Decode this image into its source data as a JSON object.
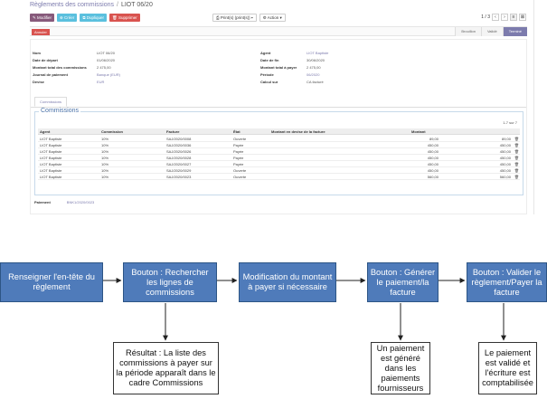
{
  "screenshot": {
    "breadcrumb": {
      "parent": "Règlements des commissions",
      "separator": "/",
      "current": "LIOT 06/20"
    },
    "buttons": {
      "modifier": "✎ Modifier",
      "creer": "⊕ Créer",
      "dupliquer": "⧉ Dupliquer",
      "supprimer": "🗑 Supprimer",
      "print": "⎙ Print(s) (print(s)) ▾",
      "action": "⚙ Action ▾"
    },
    "pager": {
      "text": "1 / 3",
      "prev": "‹",
      "next": "›",
      "grid": "≡",
      "close": "⊠"
    },
    "status": {
      "cancel": "Annuler",
      "stages": [
        "Brouillon",
        "Validé",
        "Terminé"
      ],
      "active_stage": 2
    },
    "left_fields": [
      {
        "label": "Nom",
        "value": "LIOT 06/20",
        "link": false
      },
      {
        "label": "Date de départ",
        "value": "01/06/2020",
        "link": false
      },
      {
        "label": "Montant total des commissions",
        "value": "2 475,00",
        "link": false
      },
      {
        "label": "Journal de paiement",
        "value": "Banque (EUR)",
        "link": true
      },
      {
        "label": "Devise",
        "value": "EUR",
        "link": true
      }
    ],
    "right_fields": [
      {
        "label": "Agent",
        "value": "LIOT Baptiste",
        "link": true
      },
      {
        "label": "Date de fin",
        "value": "30/06/2020",
        "link": false
      },
      {
        "label": "Montant total à payer",
        "value": "2 475,00",
        "link": false
      },
      {
        "label": "Période",
        "value": "06/2020",
        "link": true
      },
      {
        "label": "Calcul sur",
        "value": "CA facturé",
        "link": false
      }
    ],
    "tab": "Commissions",
    "group_title": "Commissions",
    "record_count": "1-7 sur 7",
    "columns": [
      "Agent",
      "Commission",
      "Facture",
      "État",
      "Montant en devise de la facture",
      "Montant"
    ],
    "rows": [
      [
        "LIOT Baptiste",
        "10%",
        "SAJ/2020/0008",
        "Ouverte",
        "89,00",
        "89,00"
      ],
      [
        "LIOT Baptiste",
        "10%",
        "SAJ/2020/0036",
        "Payée",
        "450,00",
        "450,00"
      ],
      [
        "LIOT Baptiste",
        "10%",
        "SAJ/2020/0026",
        "Payée",
        "450,00",
        "450,00"
      ],
      [
        "LIOT Baptiste",
        "10%",
        "SAJ/2020/0028",
        "Payée",
        "450,00",
        "450,00"
      ],
      [
        "LIOT Baptiste",
        "10%",
        "SAJ/2020/0027",
        "Payée",
        "450,00",
        "450,00"
      ],
      [
        "LIOT Baptiste",
        "10%",
        "SAJ/2020/0029",
        "Ouverte",
        "450,00",
        "450,00"
      ],
      [
        "LIOT Baptiste",
        "10%",
        "SAJ/2020/0023",
        "Ouverte",
        "560,00",
        "560,00"
      ]
    ],
    "payment": {
      "label": "Paiement",
      "value": "BNK1/2020/0023"
    }
  },
  "flow": {
    "steps": [
      "Renseigner l'en-tête du règlement",
      "Bouton : Rechercher les lignes de commissions",
      "Modification du montant à payer si nécessaire",
      "Bouton : Générer le paiement/la facture",
      "Bouton : Valider le règlement/Payer la facture"
    ],
    "results": [
      "Résultat : La liste des commissions à payer sur la période apparaît dans le cadre Commissions",
      "Un paiement est généré dans les paiements fournisseurs",
      "Le paiement est validé et l'écriture est comptabilisée"
    ]
  }
}
